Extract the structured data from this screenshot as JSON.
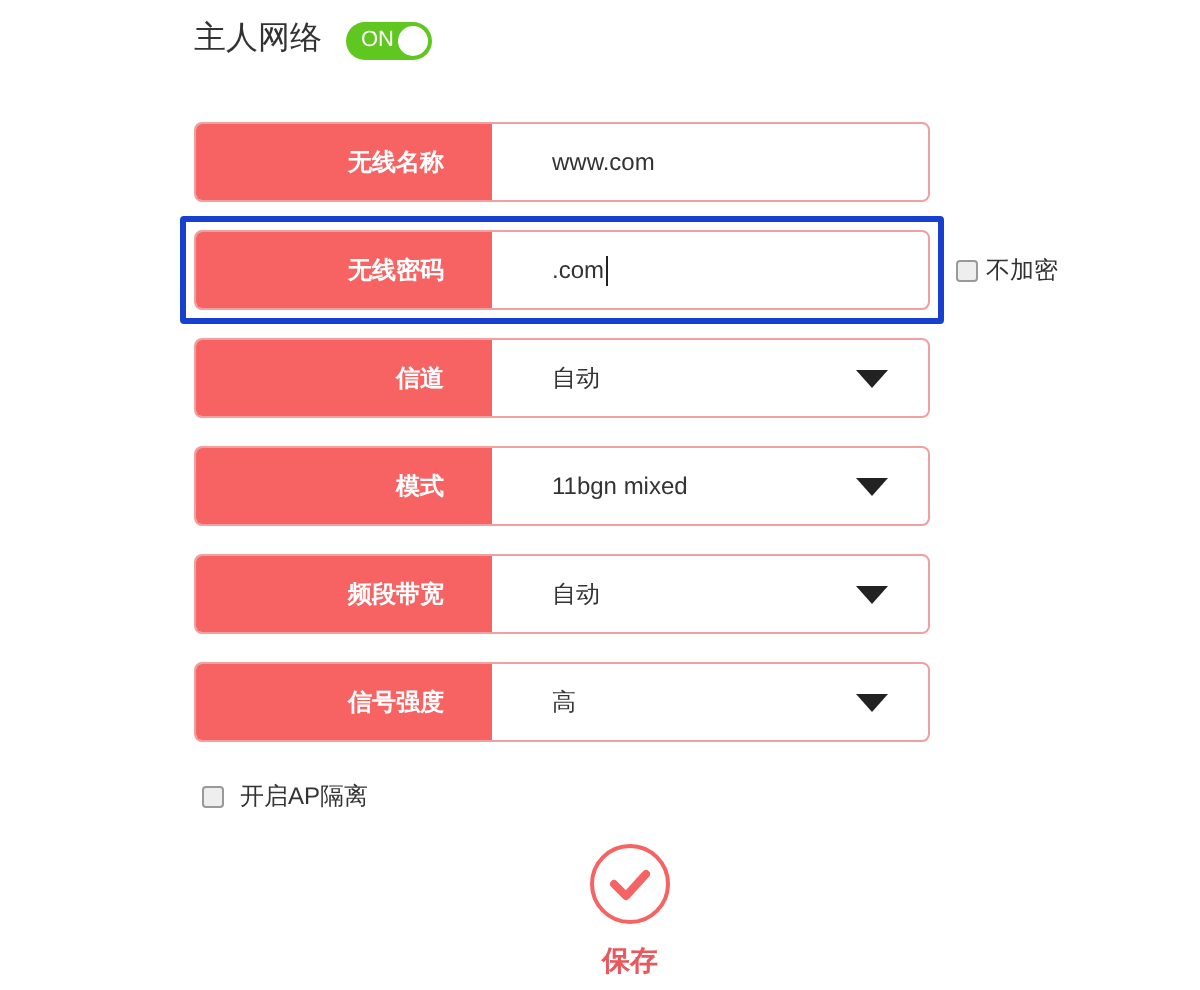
{
  "header": {
    "title": "主人网络",
    "toggle": {
      "on": true,
      "label": "ON"
    }
  },
  "fields": [
    {
      "kind": "text",
      "label": "无线名称",
      "value": "www.com"
    },
    {
      "kind": "text",
      "label": "无线密码",
      "value": ".com",
      "focused": true,
      "highlighted": true,
      "option": {
        "label": "不加密",
        "checked": false
      }
    },
    {
      "kind": "select",
      "label": "信道",
      "value": "自动"
    },
    {
      "kind": "select",
      "label": "模式",
      "value": "11bgn mixed"
    },
    {
      "kind": "select",
      "label": "频段带宽",
      "value": "自动"
    },
    {
      "kind": "select",
      "label": "信号强度",
      "value": "高"
    }
  ],
  "ap_isolation": {
    "label": "开启AP隔离",
    "checked": false
  },
  "save_button": {
    "label": "保存"
  }
}
